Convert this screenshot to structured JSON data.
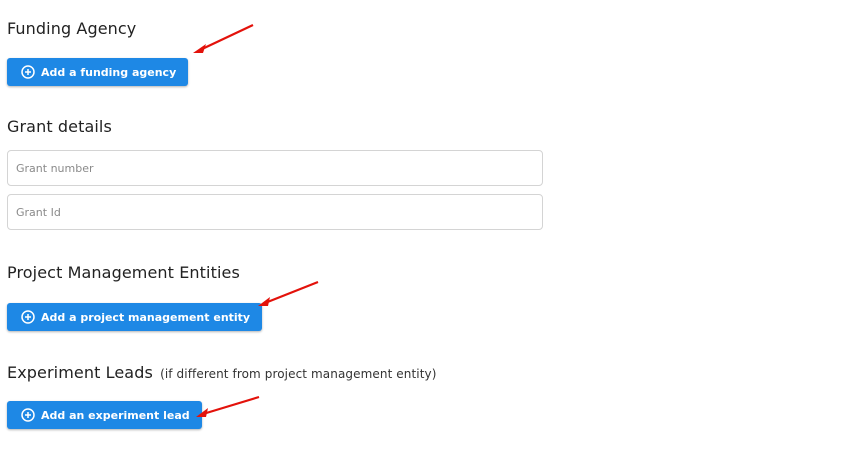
{
  "sections": {
    "funding_agency": {
      "heading": "Funding Agency",
      "button_label": "Add a funding agency"
    },
    "grant_details": {
      "heading": "Grant details",
      "grant_number_placeholder": "Grant number",
      "grant_id_placeholder": "Grant Id"
    },
    "project_management": {
      "heading": "Project Management Entities",
      "button_label": "Add a project management entity"
    },
    "experiment_leads": {
      "heading": "Experiment Leads",
      "heading_note": "(if different from project management entity)",
      "button_label": "Add an experiment lead"
    }
  },
  "colors": {
    "button": "#1e88e5",
    "annotation_arrow": "#e3120b"
  },
  "icons": {
    "button_icon": "plus-circle-icon",
    "annotation": "red-arrow-icon"
  }
}
